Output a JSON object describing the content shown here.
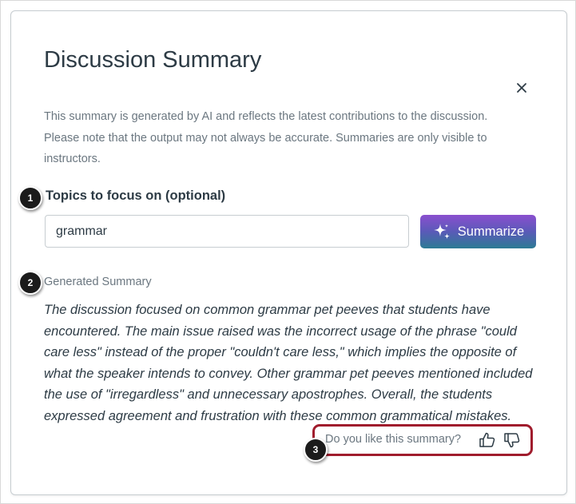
{
  "dialog": {
    "title": "Discussion Summary",
    "description": "This summary is generated by AI and reflects the latest contributions to the discussion. Please note that the output may not always be accurate. Summaries are only visible to instructors.",
    "close_icon": "close-icon"
  },
  "topics": {
    "label": "Topics to focus on (optional)",
    "value": "grammar"
  },
  "summarize_button": {
    "label": "Summarize",
    "icon": "sparkle-icon",
    "gradient_colors": [
      "#8a4fcf",
      "#5a5ab8",
      "#2d7b94"
    ]
  },
  "summary": {
    "label": "Generated Summary",
    "text": "The discussion focused on common grammar pet peeves that students have encountered. The main issue raised was the incorrect usage of the phrase \"could care less\" instead of the proper \"couldn't care less,\" which implies the opposite of what the speaker intends to convey. Other grammar pet peeves mentioned included the use of \"irregardless\" and unnecessary apostrophes. Overall, the students expressed agreement and frustration with these common grammatical mistakes."
  },
  "feedback": {
    "prompt": "Do you like this summary?",
    "like_icon": "thumbs-up-icon",
    "dislike_icon": "thumbs-down-icon",
    "highlight_color": "#a01c2d"
  },
  "callouts": [
    "1",
    "2",
    "3"
  ]
}
